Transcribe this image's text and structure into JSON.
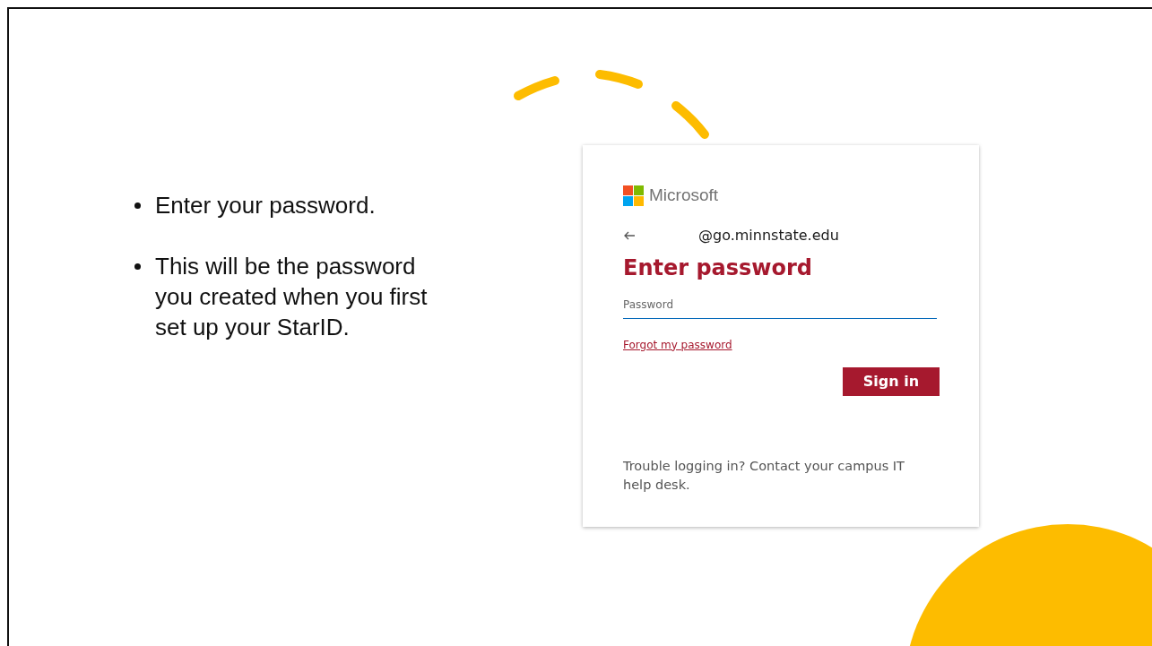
{
  "bullets": [
    "Enter your password.",
    "This will be the password you created when you first set up your StarID."
  ],
  "login": {
    "brand": "Microsoft",
    "account": "@go.minnstate.edu",
    "title": "Enter password",
    "password": {
      "placeholder": "Password"
    },
    "forgot_link": "Forgot my password",
    "button": "Sign in",
    "footer": "Trouble logging in? Contact your campus IT help desk."
  }
}
